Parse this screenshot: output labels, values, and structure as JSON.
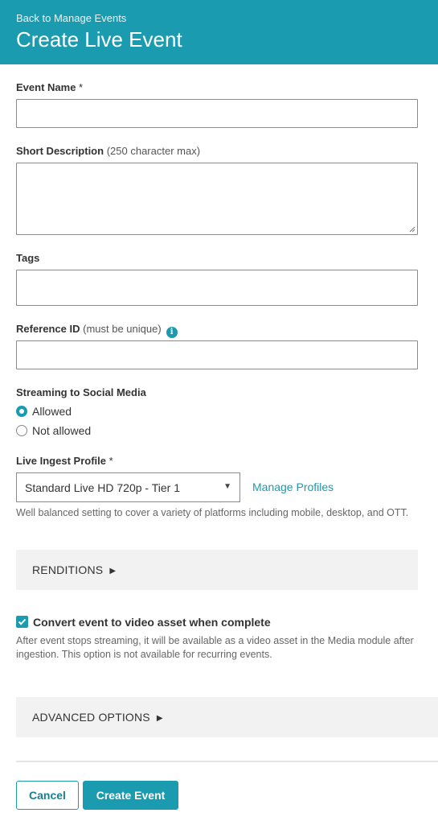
{
  "header": {
    "back_link": "Back to Manage Events",
    "title": "Create Live Event"
  },
  "form": {
    "event_name": {
      "label": "Event Name",
      "required_mark": "*",
      "value": ""
    },
    "short_description": {
      "label": "Short Description",
      "hint": "(250 character max)",
      "value": ""
    },
    "tags": {
      "label": "Tags",
      "value": ""
    },
    "reference_id": {
      "label": "Reference ID",
      "hint": "(must be unique)",
      "info_icon": "info-icon",
      "value": ""
    },
    "streaming": {
      "label": "Streaming to Social Media",
      "options": [
        {
          "label": "Allowed",
          "checked": true
        },
        {
          "label": "Not allowed",
          "checked": false
        }
      ]
    },
    "ingest_profile": {
      "label": "Live Ingest Profile",
      "required_mark": "*",
      "selected": "Standard Live HD 720p - Tier 1",
      "manage_link": "Manage Profiles",
      "help": "Well balanced setting to cover a variety of platforms including mobile, desktop, and OTT."
    },
    "renditions": {
      "label": "RENDITIONS",
      "icon": "triangle-right-icon"
    },
    "convert": {
      "label": "Convert event to video asset when complete",
      "checked": true,
      "help": "After event stops streaming, it will be available as a video asset in the Media module after ingestion. This option is not available for recurring events."
    },
    "advanced": {
      "label": "ADVANCED OPTIONS",
      "icon": "triangle-right-icon"
    }
  },
  "actions": {
    "cancel": "Cancel",
    "create": "Create Event"
  },
  "colors": {
    "accent": "#1a9bb0",
    "panel": "#f2f2f2"
  }
}
